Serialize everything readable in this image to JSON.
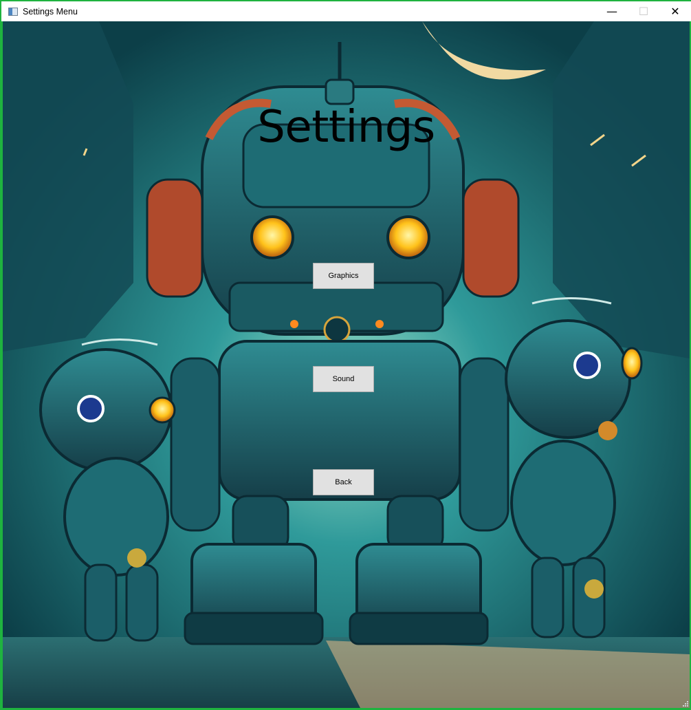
{
  "window": {
    "title": "Settings Menu",
    "controls": {
      "minimize": "—",
      "maximize": "☐",
      "close": "✕"
    }
  },
  "menu": {
    "heading": "Settings",
    "buttons": [
      {
        "label": "Graphics"
      },
      {
        "label": "Sound"
      },
      {
        "label": "Back"
      }
    ]
  },
  "colors": {
    "frame": "#1fb33f",
    "button_face": "#e1e1e1",
    "button_border": "#adadad",
    "background_teal": "#0f4f57"
  },
  "background": {
    "description_icon": "robot-artwork"
  }
}
